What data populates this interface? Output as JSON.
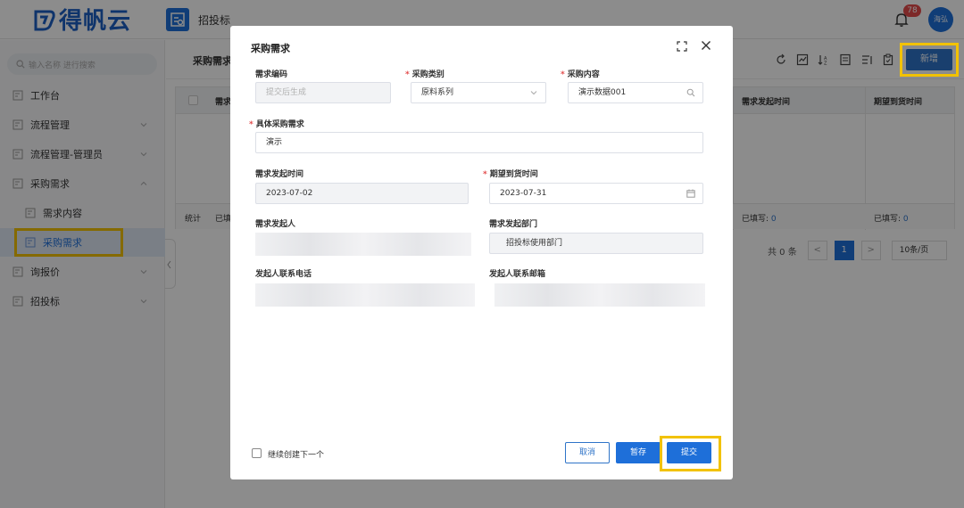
{
  "header": {
    "logo_text": "得帆云",
    "app_title": "招投标",
    "notification_count": "78",
    "user_name": "海弘"
  },
  "sidebar": {
    "search_placeholder": "输入名称 进行搜索",
    "items": [
      {
        "label": "工作台"
      },
      {
        "label": "流程管理"
      },
      {
        "label": "流程管理-管理员"
      },
      {
        "label": "采购需求"
      },
      {
        "label": "需求内容"
      },
      {
        "label": "采购需求"
      },
      {
        "label": "询报价"
      },
      {
        "label": "招投标"
      }
    ]
  },
  "content": {
    "title": "采购需求",
    "new_button": "新增",
    "columns": [
      "需求",
      "需求发起时间",
      "期望到货时间"
    ],
    "summary": {
      "label": "统计",
      "cell_prefix": "已填",
      "filled_label": "已填写:",
      "filled_value": "0"
    },
    "pager": {
      "total": "共 0 条",
      "prev": "<",
      "current": "1",
      "next": ">",
      "page_size": "10条/页"
    }
  },
  "modal": {
    "title": "采购需求",
    "fields": {
      "req_code": {
        "label": "需求编码",
        "placeholder": "提交后生成"
      },
      "category": {
        "label": "采购类别",
        "value": "原料系列"
      },
      "content": {
        "label": "采购内容",
        "value": "演示数据001"
      },
      "detail": {
        "label": "具体采购需求",
        "value": "演示"
      },
      "start_time": {
        "label": "需求发起时间",
        "value": "2023-07-02"
      },
      "expected_time": {
        "label": "期望到货时间",
        "value": "2023-07-31"
      },
      "initiator": {
        "label": "需求发起人"
      },
      "department": {
        "label": "需求发起部门",
        "value": "招投标使用部门"
      },
      "phone": {
        "label": "发起人联系电话"
      },
      "email": {
        "label": "发起人联系邮箱"
      }
    },
    "continue_label": "继续创建下一个",
    "buttons": {
      "cancel": "取消",
      "save": "暂存",
      "submit": "提交"
    }
  },
  "colors": {
    "accent": "#1e6fd9",
    "highlight": "#f2c200",
    "required": "#e34c4c"
  }
}
